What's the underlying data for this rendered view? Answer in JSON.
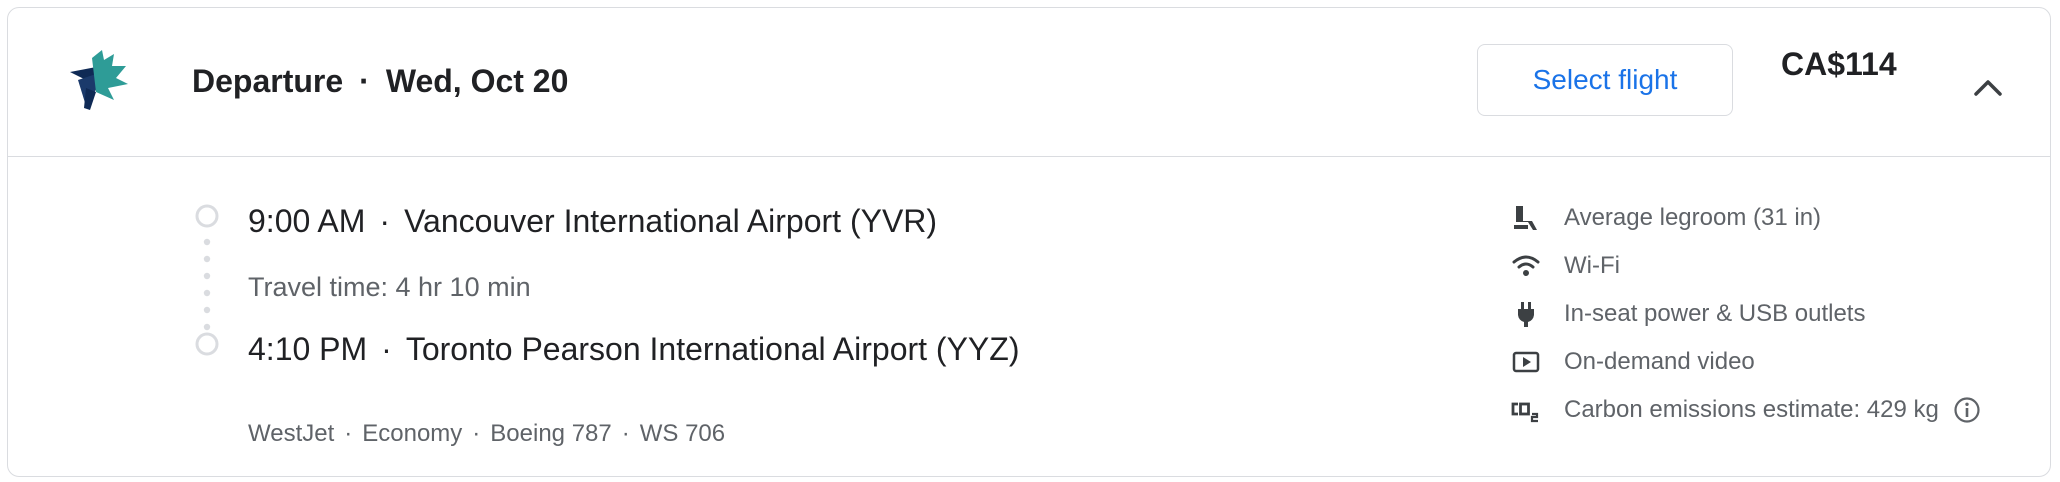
{
  "header": {
    "title": "Departure",
    "date": "Wed, Oct 20",
    "select_button": "Select flight",
    "price": "CA$114"
  },
  "flight": {
    "departure_time": "9:00 AM",
    "departure_airport": "Vancouver International Airport (YVR)",
    "travel_time": "Travel time: 4 hr 10 min",
    "arrival_time": "4:10 PM",
    "arrival_airport": "Toronto Pearson International Airport (YYZ)",
    "airline": "WestJet",
    "cabin": "Economy",
    "aircraft": "Boeing 787",
    "flight_number": "WS 706"
  },
  "amenities": [
    {
      "icon": "seat-icon",
      "label": "Average legroom (31 in)"
    },
    {
      "icon": "wifi-icon",
      "label": "Wi-Fi"
    },
    {
      "icon": "power-plug-icon",
      "label": "In-seat power & USB outlets"
    },
    {
      "icon": "video-icon",
      "label": "On-demand video"
    },
    {
      "icon": "co2-icon",
      "label": "Carbon emissions estimate: 429 kg"
    }
  ],
  "colors": {
    "accent_blue": "#1a73e8",
    "text_primary": "#202124",
    "text_secondary": "#5f6368",
    "border": "#dadce0",
    "logo_teal": "#2e9c97",
    "logo_navy": "#0f2a55"
  }
}
